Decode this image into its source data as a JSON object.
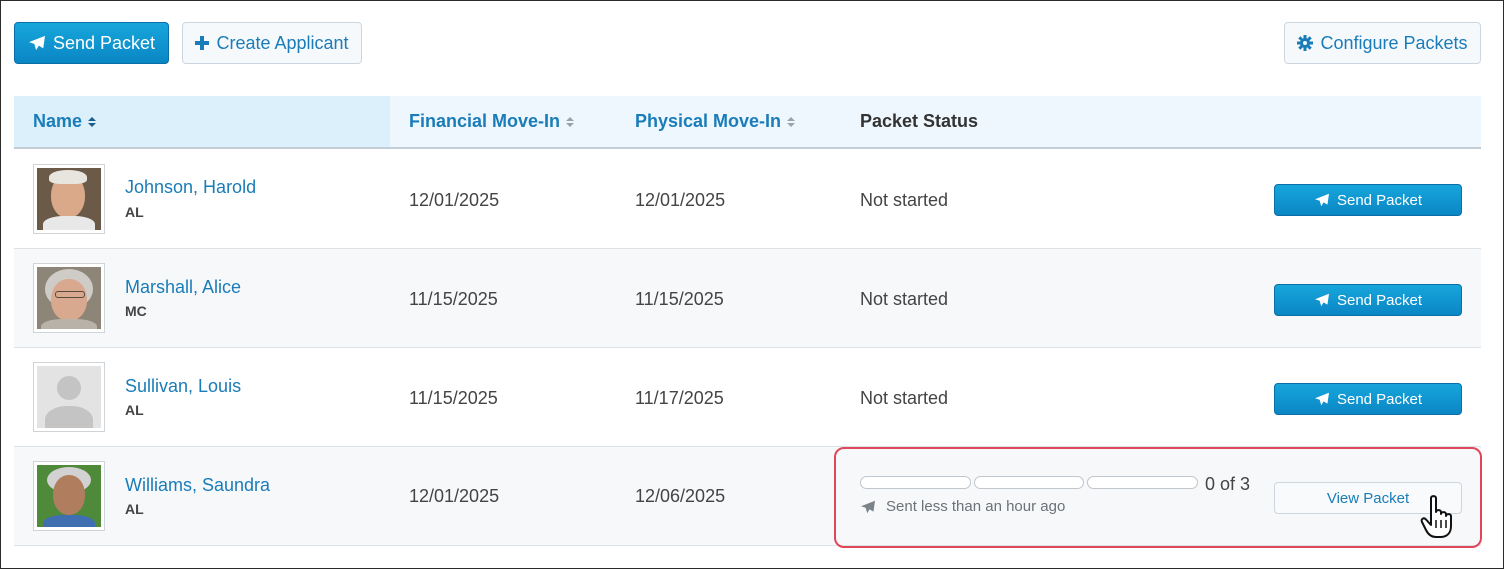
{
  "toolbar": {
    "send_packet_label": "Send Packet",
    "create_applicant_label": "Create Applicant",
    "configure_packets_label": "Configure Packets"
  },
  "table": {
    "columns": {
      "name": "Name",
      "financial": "Financial Move-In",
      "physical": "Physical Move-In",
      "status": "Packet Status"
    },
    "rows": [
      {
        "name": "Johnson, Harold",
        "type": "AL",
        "financial": "12/01/2025",
        "physical": "12/01/2025",
        "status": "Not started",
        "action": "Send Packet"
      },
      {
        "name": "Marshall, Alice",
        "type": "MC",
        "financial": "11/15/2025",
        "physical": "11/15/2025",
        "status": "Not started",
        "action": "Send Packet"
      },
      {
        "name": "Sullivan, Louis",
        "type": "AL",
        "financial": "11/15/2025",
        "physical": "11/17/2025",
        "status": "Not started",
        "action": "Send Packet"
      },
      {
        "name": "Williams, Saundra",
        "type": "AL",
        "financial": "12/01/2025",
        "physical": "12/06/2025",
        "progress": {
          "completed": 0,
          "total": 3,
          "label": "0 of 3"
        },
        "sent_text": "Sent less than an hour ago",
        "action": "View Packet"
      }
    ]
  },
  "colors": {
    "primary": "#0a86c4",
    "link": "#1a7cb8",
    "highlight": "#e0475a"
  },
  "icons": [
    "paper-plane-icon",
    "plus-icon",
    "gear-icon",
    "sort-icon",
    "hand-cursor-icon"
  ]
}
